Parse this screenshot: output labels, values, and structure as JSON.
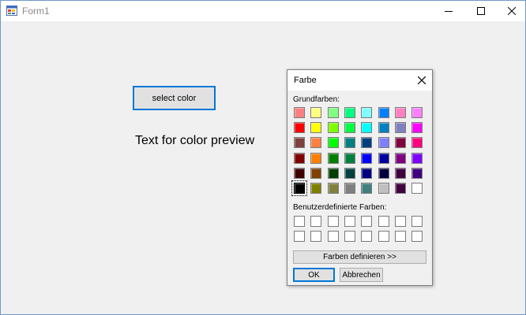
{
  "window": {
    "title": "Form1",
    "icon": "form-app-icon",
    "controls": [
      "minimize-icon",
      "maximize-icon",
      "close-icon"
    ]
  },
  "main": {
    "select_color_label": "select color",
    "preview_text": "Text for color preview"
  },
  "dialog": {
    "title": "Farbe",
    "basic_label": "Grundfarben:",
    "custom_label": "Benutzerdefinierte Farben:",
    "define_label": "Farben definieren >>",
    "ok_label": "OK",
    "cancel_label": "Abbrechen",
    "selected_color": "#000000",
    "basic_colors": [
      [
        "#ff8080",
        "#ffff80",
        "#80ff80",
        "#00ff80",
        "#80ffff",
        "#0080ff",
        "#ff80c0",
        "#ff80ff"
      ],
      [
        "#ff0000",
        "#ffff00",
        "#80ff00",
        "#00ff40",
        "#00ffff",
        "#0080c0",
        "#8080c0",
        "#ff00ff"
      ],
      [
        "#804040",
        "#ff8040",
        "#00ff00",
        "#008080",
        "#004080",
        "#8080ff",
        "#800040",
        "#ff0080"
      ],
      [
        "#800000",
        "#ff8000",
        "#008000",
        "#008040",
        "#0000ff",
        "#0000a0",
        "#800080",
        "#8000ff"
      ],
      [
        "#400000",
        "#804000",
        "#004000",
        "#004040",
        "#000080",
        "#000040",
        "#400040",
        "#400080"
      ],
      [
        "#000000",
        "#808000",
        "#808040",
        "#808080",
        "#408080",
        "#c0c0c0",
        "#400040",
        "#ffffff"
      ]
    ],
    "custom_colors": [
      [
        "#ffffff",
        "#ffffff",
        "#ffffff",
        "#ffffff",
        "#ffffff",
        "#ffffff",
        "#ffffff",
        "#ffffff"
      ],
      [
        "#ffffff",
        "#ffffff",
        "#ffffff",
        "#ffffff",
        "#ffffff",
        "#ffffff",
        "#ffffff",
        "#ffffff"
      ]
    ]
  },
  "colors": {
    "accent": "#0078d7",
    "window_border": "#6f9ac9",
    "background": "#f0f0f0"
  }
}
